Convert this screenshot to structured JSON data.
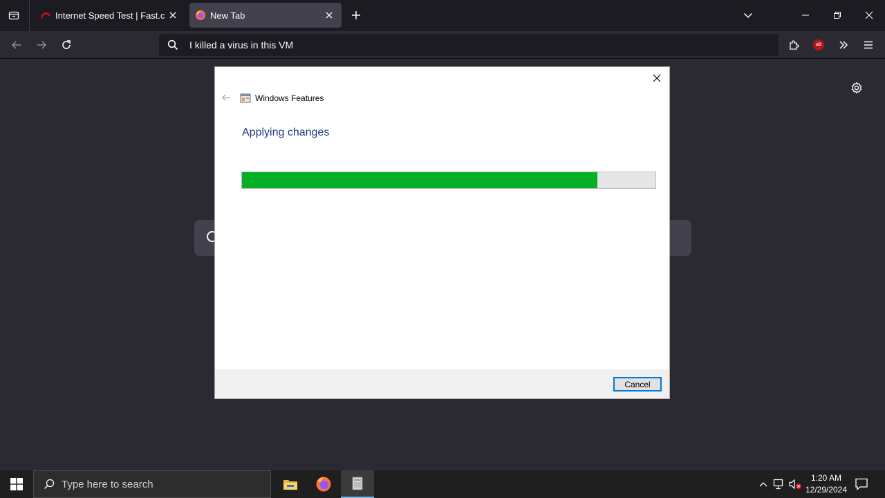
{
  "browser": {
    "tabs": [
      {
        "title": "Internet Speed Test | Fast.com",
        "favicon": "fast-com-icon",
        "active": false
      },
      {
        "title": "New Tab",
        "favicon": "firefox-icon",
        "active": true
      }
    ],
    "new_tab_symbol": "+",
    "url_text": "I killed a virus in this VM",
    "extension_badge": "uD"
  },
  "dialog": {
    "title": "Windows Features",
    "heading": "Applying changes",
    "progress_fraction": 0.86,
    "cancel_label": "Cancel"
  },
  "taskbar": {
    "search_placeholder": "Type here to search",
    "apps": [
      "file-explorer-icon",
      "firefox-icon",
      "windows-features-icon"
    ],
    "time": "1:20 AM",
    "date": "12/29/2024"
  },
  "colors": {
    "progress_green": "#06b025",
    "dialog_heading_blue": "#1e3d86",
    "cancel_focus_blue": "#0078d7",
    "browser_bg": "#2b2a33",
    "tabbar_bg": "#1c1b22"
  }
}
